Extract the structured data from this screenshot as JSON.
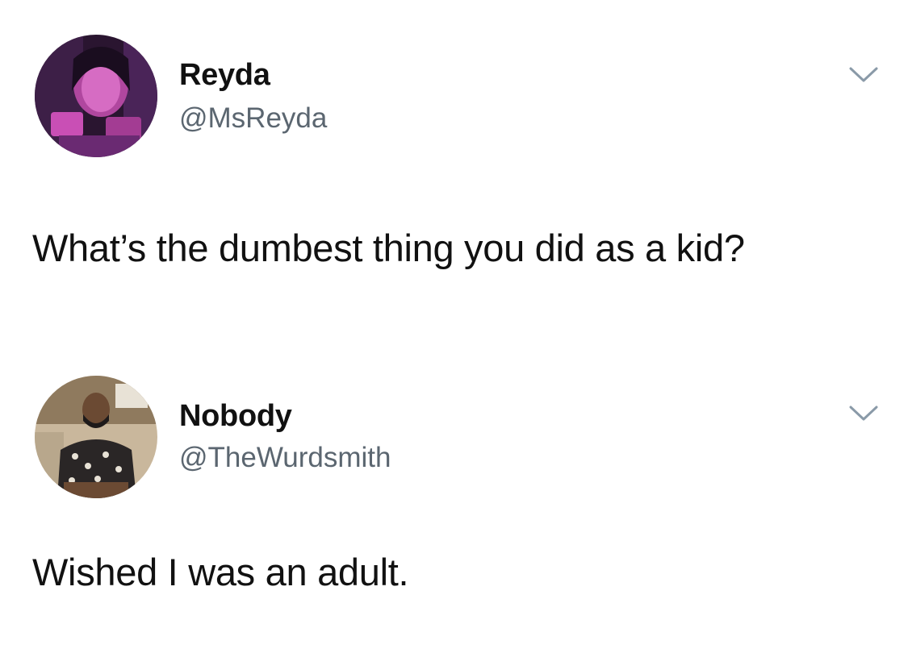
{
  "tweets": [
    {
      "display_name": "Reyda",
      "handle": "@MsReyda",
      "text": "What’s the dumbest thing you did as a kid?",
      "avatar_colors": {
        "primary": "#7a2a8c",
        "secondary": "#c94fb5",
        "dark": "#2a1530"
      }
    },
    {
      "display_name": "Nobody",
      "handle": "@TheWurdsmith",
      "text": "Wished I was an adult.",
      "avatar_colors": {
        "primary": "#6b4a33",
        "secondary": "#c9b79c",
        "dark": "#1e1a1a"
      }
    }
  ],
  "icons": {
    "menu": "chevron-down-icon"
  },
  "colors": {
    "handle": "#5b6670",
    "text": "#111111",
    "chevron": "#8a9aa8"
  }
}
